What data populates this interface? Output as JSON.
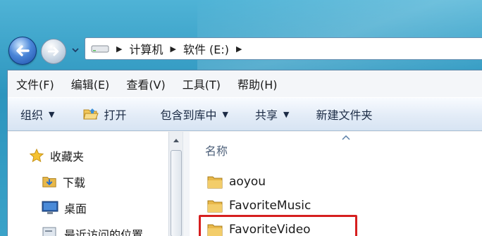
{
  "address_bar": {
    "segments": [
      "计算机",
      "软件 (E:)"
    ]
  },
  "menubar": {
    "items": [
      "文件(F)",
      "编辑(E)",
      "查看(V)",
      "工具(T)",
      "帮助(H)"
    ]
  },
  "toolbar": {
    "organize": "组织",
    "open": "打开",
    "include_in_library": "包含到库中",
    "share": "共享",
    "new_folder": "新建文件夹"
  },
  "navpane": {
    "favorites_label": "收藏夹",
    "items": [
      "下载",
      "桌面",
      "最近访问的位置"
    ]
  },
  "content": {
    "column_header": "名称",
    "files": [
      "aoyou",
      "FavoriteMusic",
      "FavoriteVideo"
    ],
    "selected_file": "FavoriteVideo"
  },
  "colors": {
    "highlight_border": "#d61f1f",
    "folder": "#e8b84a",
    "selection": "#dfeefe"
  }
}
